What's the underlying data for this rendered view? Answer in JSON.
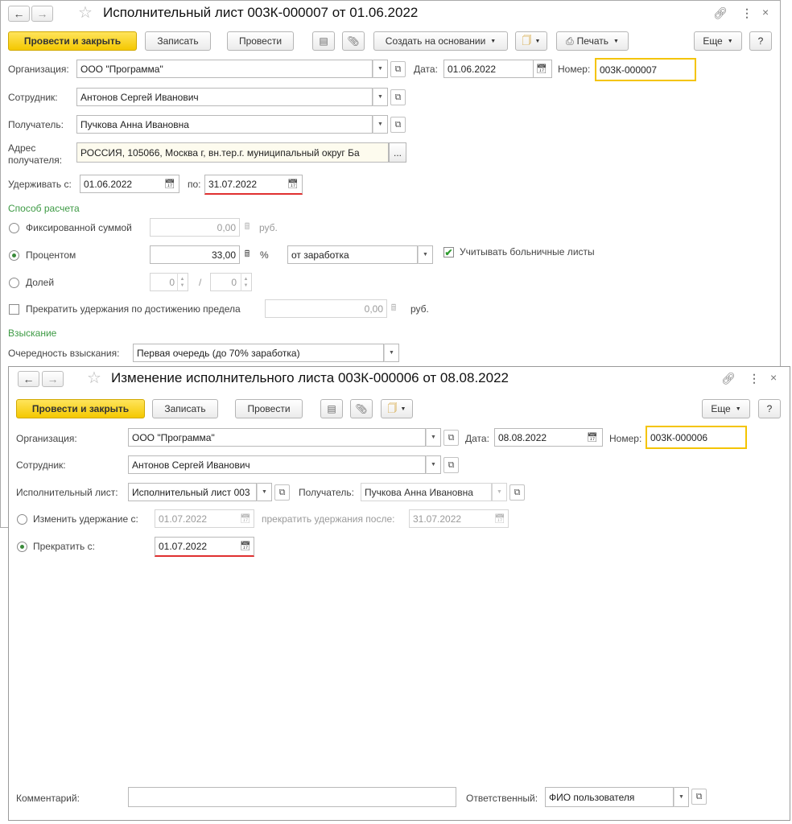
{
  "back_window": {
    "title": "Исполнительный лист 003К-000007 от 01.06.2022",
    "toolbar": {
      "post_close": "Провести и закрыть",
      "save": "Записать",
      "post": "Провести",
      "create_based": "Создать на основании",
      "print": "Печать",
      "more": "Еще",
      "help": "?"
    },
    "org_label": "Организация:",
    "org_value": "ООО \"Программа\"",
    "date_label": "Дата:",
    "date_value": "01.06.2022",
    "number_label": "Номер:",
    "number_value": "003К-000007",
    "employee_label": "Сотрудник:",
    "employee_value": "Антонов Сергей Иванович",
    "recipient_label": "Получатель:",
    "recipient_value": "Пучкова Анна Ивановна",
    "address_label_1": "Адрес",
    "address_label_2": "получателя:",
    "address_value": "РОССИЯ, 105066, Москва г, вн.тер.г. муниципальный округ Ба",
    "address_btn": "...",
    "hold_from_label": "Удерживать с:",
    "hold_from_value": "01.06.2022",
    "hold_to_label": "по:",
    "hold_to_value": "31.07.2022",
    "calc_section": "Способ расчета",
    "fixed_label": "Фиксированной суммой",
    "fixed_value": "0,00",
    "fixed_unit": "руб.",
    "percent_label": "Процентом",
    "percent_value": "33,00",
    "percent_unit": "%",
    "percent_base": "от заработка",
    "sick_label": "Учитывать больничные листы",
    "share_label": "Долей",
    "share_num": "0",
    "share_sep": "/",
    "share_den": "0",
    "limit_label": "Прекратить удержания по достижению предела",
    "limit_value": "0,00",
    "limit_unit": "руб.",
    "collect_section": "Взыскание",
    "order_label": "Очередность взыскания:",
    "order_value": "Первая очередь (до 70% заработка)"
  },
  "front_window": {
    "title": "Изменение исполнительного листа 003К-000006 от 08.08.2022",
    "toolbar": {
      "post_close": "Провести и закрыть",
      "save": "Записать",
      "post": "Провести",
      "more": "Еще",
      "help": "?"
    },
    "org_label": "Организация:",
    "org_value": "ООО \"Программа\"",
    "date_label": "Дата:",
    "date_value": "08.08.2022",
    "number_label": "Номер:",
    "number_value": "003К-000006",
    "employee_label": "Сотрудник:",
    "employee_value": "Антонов Сергей Иванович",
    "writ_label": "Исполнительный лист:",
    "writ_value": "Исполнительный лист 003",
    "recipient_label": "Получатель:",
    "recipient_value": "Пучкова Анна Ивановна",
    "change_label": "Изменить удержание с:",
    "change_value": "01.07.2022",
    "stop_after_label": "прекратить удержания после:",
    "stop_after_value": "31.07.2022",
    "stop_label": "Прекратить с:",
    "stop_value": "01.07.2022",
    "comment_label": "Комментарий:",
    "comment_value": "",
    "responsible_label": "Ответственный:",
    "responsible_value": "ФИО пользователя"
  }
}
